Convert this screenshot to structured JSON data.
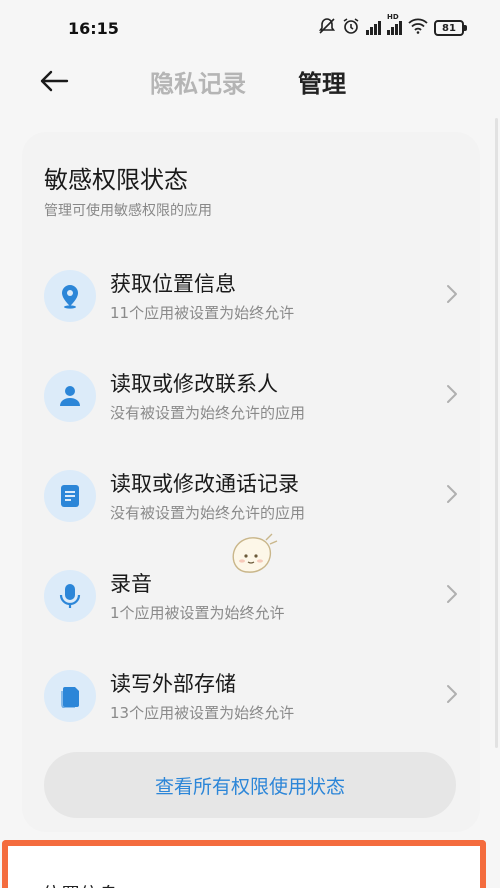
{
  "status_bar": {
    "time": "16:15",
    "battery": "81",
    "hd_label": "HD"
  },
  "nav": {
    "tab_inactive": "隐私记录",
    "tab_active": "管理"
  },
  "section": {
    "title": "敏感权限状态",
    "subtitle": "管理可使用敏感权限的应用"
  },
  "permissions": [
    {
      "icon": "location-icon",
      "title": "获取位置信息",
      "desc": "11个应用被设置为始终允许"
    },
    {
      "icon": "contacts-icon",
      "title": "读取或修改联系人",
      "desc": "没有被设置为始终允许的应用"
    },
    {
      "icon": "call-log-icon",
      "title": "读取或修改通话记录",
      "desc": "没有被设置为始终允许的应用"
    },
    {
      "icon": "microphone-icon",
      "title": "录音",
      "desc": "1个应用被设置为始终允许"
    },
    {
      "icon": "storage-icon",
      "title": "读写外部存储",
      "desc": "13个应用被设置为始终允许"
    }
  ],
  "view_all_label": "查看所有权限使用状态",
  "bottom_section_title": "位置信息",
  "colors": {
    "accent": "#2c86d8",
    "icon_bg": "#dcebf9",
    "highlight_border": "#f46c3e"
  }
}
